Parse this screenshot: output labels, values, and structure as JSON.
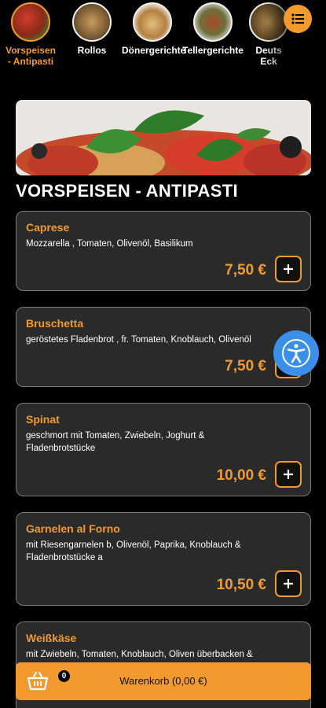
{
  "categories": [
    {
      "label_line1": "Vorspeisen",
      "label_line2": "- Antipasti",
      "active": true
    },
    {
      "label_line1": "Rollos",
      "label_line2": ""
    },
    {
      "label_line1": "Dönergerichte",
      "label_line2": ""
    },
    {
      "label_line1": "Tellergerichte",
      "label_line2": ""
    },
    {
      "label_line1": "Deuts",
      "label_line2": "Eck"
    }
  ],
  "section": {
    "title": "VORSPEISEN - ANTIPASTI"
  },
  "items": [
    {
      "name": "Caprese",
      "description": "Mozzarella , Tomaten, Olivenöl, Basilikum",
      "price": "7,50 €"
    },
    {
      "name": "Bruschetta",
      "description": "geröstetes Fladenbrot , fr. Tomaten, Knoblauch, Olivenöl",
      "price": "7,50 €"
    },
    {
      "name": "Spinat",
      "description": "geschmort mit Tomaten, Zwiebeln, Joghurt & Fladenbrotstücke",
      "price": "10,00 €"
    },
    {
      "name": "Garnelen al Forno",
      "description": "mit Riesengarnelen b, Olivenöl, Paprika, Knoblauch & Fladenbrotstücke a",
      "price": "10,50 €"
    },
    {
      "name": "Weißkäse",
      "description": "mit Zwiebeln, Tomaten, Knoblauch, Oliven überbacken &",
      "price": ""
    }
  ],
  "add_symbol": "+",
  "cart": {
    "label": "Warenkorb (0,00 €)",
    "count": "0"
  },
  "colors": {
    "accent": "#f29a2e",
    "card_bg": "#2a2a2a",
    "a11y": "#3a90e8"
  },
  "icons": [
    "menu-list-icon",
    "plus-icon",
    "accessibility-icon",
    "basket-icon"
  ]
}
